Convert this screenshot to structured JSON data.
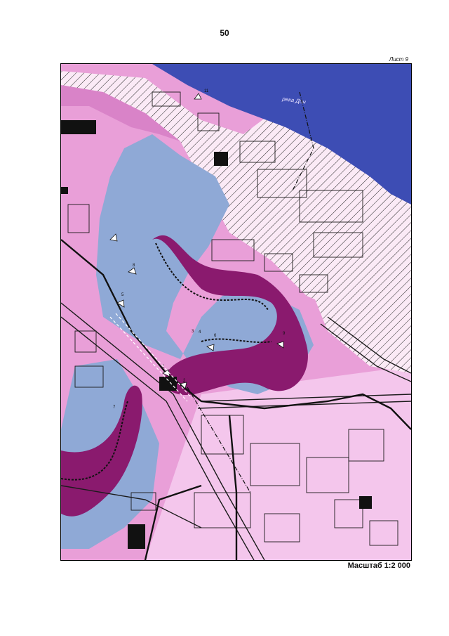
{
  "page": {
    "number": "50",
    "sheet": "Лист 9"
  },
  "map": {
    "river_label": "река Дон",
    "point_labels": [
      "1",
      "2",
      "3",
      "4",
      "5",
      "6",
      "7",
      "8",
      "9",
      "11"
    ],
    "colors": {
      "river": "#3d4db4",
      "zone_light": "#f0b8e6",
      "zone_pink": "#e89ad6",
      "zone_dark": "#8a1a6e",
      "water_body": "#8faad6",
      "hatch_background": "#fbe8f6"
    }
  },
  "footer": {
    "scale": "Масштаб 1:2 000"
  }
}
